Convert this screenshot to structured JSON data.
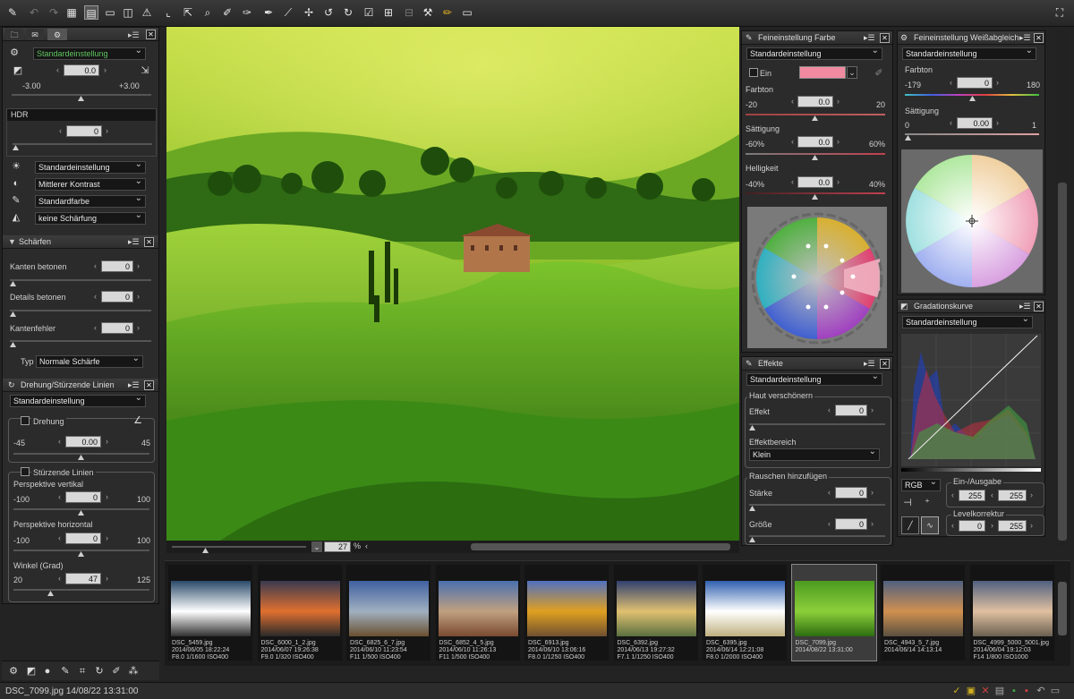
{
  "toolbar": {
    "icons": [
      "brush-icon",
      "undo-icon",
      "redo-icon",
      "grid-view-icon",
      "filmstrip-view-icon",
      "single-view-icon",
      "compare-view-icon",
      "warning-icon",
      "crop-icon",
      "rotate-icon",
      "zoom-icon",
      "eyedropper-icon",
      "white-balance-eyedropper-icon",
      "auto-retouch-icon",
      "paint-brush-icon",
      "control-point-icon",
      "rotate-left-icon",
      "rotate-right-icon",
      "checkbox-icon",
      "network-icon",
      "network-off-icon",
      "hammer-icon",
      "pen-icon",
      "monitor-icon",
      "fullscreen-icon"
    ]
  },
  "left": {
    "tabs": [
      "folder-tab",
      "comment-tab",
      "settings-tab"
    ],
    "exposure": {
      "preset": "Standardeinstellung",
      "value": "0.0",
      "min": "-3.00",
      "max": "+3.00"
    },
    "hdr": {
      "title": "HDR",
      "value": "0"
    },
    "picture_control": [
      "Standardeinstellung",
      "Mittlerer Kontrast",
      "Standardfarbe",
      "keine Schärfung"
    ],
    "sharpen": {
      "title": "Schärfen",
      "rows": [
        {
          "label": "Kanten betonen",
          "value": "0"
        },
        {
          "label": "Details betonen",
          "value": "0"
        },
        {
          "label": "Kantenfehler",
          "value": "0"
        }
      ],
      "type_label": "Typ",
      "type_value": "Normale Schärfe"
    },
    "rotation": {
      "title": "Drehung/Stürzende Linien",
      "preset": "Standardeinstellung",
      "rot_label": "Drehung",
      "rot_min": "-45",
      "rot_value": "0.00",
      "rot_max": "45",
      "persp_label": "Stürzende Linien",
      "v_label": "Perspektive vertikal",
      "v_min": "-100",
      "v_value": "0",
      "v_max": "100",
      "h_label": "Perspektive horizontal",
      "h_min": "-100",
      "h_value": "0",
      "h_max": "100",
      "angle_label": "Winkel (Grad)",
      "a_min": "20",
      "a_value": "47",
      "a_max": "125"
    }
  },
  "viewer": {
    "zoom": "27",
    "zoom_unit": "%"
  },
  "color": {
    "title": "Feineinstellung Farbe",
    "preset": "Standardeinstellung",
    "on_label": "Ein",
    "swatch": "#f08aa0",
    "hue_label": "Farbton",
    "hue_min": "-20",
    "hue_value": "0.0",
    "hue_max": "20",
    "sat_label": "Sättigung",
    "sat_min": "-60%",
    "sat_value": "0.0",
    "sat_max": "60%",
    "bri_label": "Helligkeit",
    "bri_min": "-40%",
    "bri_value": "0.0",
    "bri_max": "40%"
  },
  "wb": {
    "title": "Feineinstellung Weißabgleich",
    "preset": "Standardeinstellung",
    "hue_label": "Farbton",
    "hue_min": "-179",
    "hue_value": "0",
    "hue_max": "180",
    "sat_label": "Sättigung",
    "sat_min": "0",
    "sat_value": "0.00",
    "sat_max": "1"
  },
  "effects": {
    "title": "Effekte",
    "preset": "Standardeinstellung",
    "skin_label": "Haut verschönern",
    "effect_label": "Effekt",
    "effect_value": "0",
    "area_label": "Effektbereich",
    "area_value": "Klein",
    "noise_label": "Rauschen hinzufügen",
    "strength_label": "Stärke",
    "strength_value": "0",
    "size_label": "Größe",
    "size_value": "0"
  },
  "curve": {
    "title": "Gradationskurve",
    "preset": "Standardeinstellung",
    "channel": "RGB",
    "io_label": "Ein-/Ausgabe",
    "in_value": "255",
    "out_value": "255",
    "levels_label": "Levelkorrektur",
    "lvl_min": "0",
    "lvl_max": "255"
  },
  "filmstrip": [
    {
      "name": "DSC_5459.jpg",
      "date": "2014/06/05 18:22:24",
      "exif": "F8.0 1/1600 ISO400"
    },
    {
      "name": "DSC_6000_1_2.jpg",
      "date": "2014/06/07 19:26:38",
      "exif": "F9.0 1/320 ISO400"
    },
    {
      "name": "DSC_6825_6_7.jpg",
      "date": "2014/06/10 11:23:54",
      "exif": "F11 1/500 ISO400"
    },
    {
      "name": "DSC_6852_4_5.jpg",
      "date": "2014/06/10 11:26:13",
      "exif": "F11 1/500 ISO400"
    },
    {
      "name": "DSC_6913.jpg",
      "date": "2014/06/10 13:06:16",
      "exif": "F8.0 1/1250 ISO400"
    },
    {
      "name": "DSC_6392.jpg",
      "date": "2014/06/13 19:27:32",
      "exif": "F7.1 1/1250 ISO400"
    },
    {
      "name": "DSC_6395.jpg",
      "date": "2014/06/14 12:21:08",
      "exif": "F8.0 1/2000 ISO400"
    },
    {
      "name": "DSC_7099.jpg",
      "date": "2014/08/22 13:31:00",
      "exif": ""
    },
    {
      "name": "DSC_4943_5_7.jpg",
      "date": "2014/06/14 14:13:14",
      "exif": ""
    },
    {
      "name": "DSC_4999_5000_5001.jpg",
      "date": "2014/06/04 19:12:03",
      "exif": "F14 1/800 ISO1000"
    }
  ],
  "status": {
    "text": "DSC_7099.jpg 14/08/22 13:31:00"
  }
}
